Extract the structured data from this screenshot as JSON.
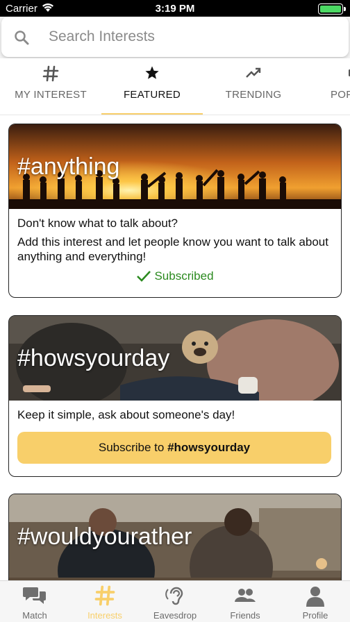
{
  "status_bar": {
    "carrier": "Carrier",
    "time": "3:19 PM",
    "battery_level": 1.0
  },
  "search": {
    "placeholder": "Search Interests",
    "value": ""
  },
  "tabs": [
    {
      "label": "MY INTEREST",
      "icon": "hash-icon",
      "active": false
    },
    {
      "label": "FEATURED",
      "icon": "star-icon",
      "active": true
    },
    {
      "label": "TRENDING",
      "icon": "trending-icon",
      "active": false
    },
    {
      "label": "POP",
      "icon": "popular-icon",
      "active": false
    }
  ],
  "cards": [
    {
      "hashtag": "#anything",
      "line1": "Don't know what to talk about?",
      "line2": "Add this interest and let people know you want to talk about anything and everything!",
      "status": "Subscribed"
    },
    {
      "hashtag": "#howsyourday",
      "line1": "Keep it simple, ask about someone's day!",
      "button_prefix": "Subscribe to ",
      "button_tag": "#howsyourday"
    },
    {
      "hashtag": "#wouldyourather"
    }
  ],
  "bottom_nav": [
    {
      "label": "Match",
      "icon": "chat-bubbles-icon",
      "active": false
    },
    {
      "label": "Interests",
      "icon": "hash-icon",
      "active": true
    },
    {
      "label": "Eavesdrop",
      "icon": "ear-icon",
      "active": false
    },
    {
      "label": "Friends",
      "icon": "friends-icon",
      "active": false
    },
    {
      "label": "Profile",
      "icon": "profile-icon",
      "active": false
    }
  ],
  "colors": {
    "accent": "#f8cf6a",
    "subscribed_green": "#2b8a1f",
    "battery_green": "#4cd964"
  }
}
